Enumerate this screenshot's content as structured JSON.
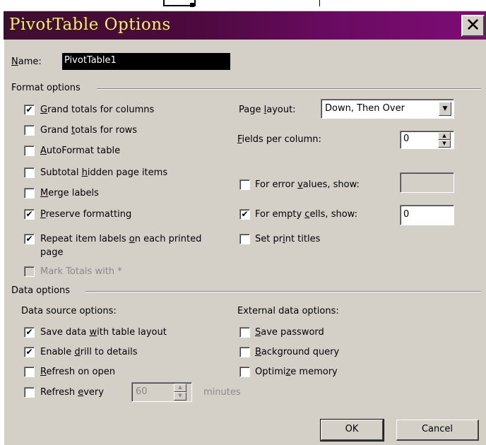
{
  "dialog": {
    "title": "PivotTable Options",
    "close_glyph": "✕"
  },
  "name": {
    "label": "Name:",
    "value": "PivotTable1"
  },
  "format_options": {
    "heading": "Format options",
    "grand_totals_columns": {
      "label": "Grand totals for columns",
      "checked": true
    },
    "grand_totals_rows": {
      "label": "Grand totals for rows",
      "checked": false
    },
    "autoformat": {
      "label": "AutoFormat table",
      "checked": false
    },
    "subtotal_hidden": {
      "label": "Subtotal hidden page items",
      "checked": false
    },
    "merge_labels": {
      "label": "Merge labels",
      "checked": false
    },
    "preserve_formatting": {
      "label": "Preserve formatting",
      "checked": true
    },
    "repeat_labels": {
      "label_line1": "Repeat item labels on each printed",
      "label_line2": "page",
      "checked": true
    },
    "mark_totals": {
      "label": "Mark Totals with *",
      "checked": false,
      "disabled": true
    },
    "page_layout": {
      "label": "Page layout:",
      "value": "Down, Then Over"
    },
    "fields_per_column": {
      "label": "Fields per column:",
      "value": "0"
    },
    "error_values": {
      "label": "For error values, show:",
      "checked": false,
      "value": ""
    },
    "empty_cells": {
      "label": "For empty cells, show:",
      "checked": true,
      "value": "0"
    },
    "print_titles": {
      "label": "Set print titles",
      "checked": false
    }
  },
  "data_options": {
    "heading": "Data options",
    "source_heading": "Data source options:",
    "external_heading": "External data options:",
    "save_data": {
      "label": "Save data with table layout",
      "checked": true
    },
    "enable_drill": {
      "label": "Enable drill to details",
      "checked": true
    },
    "refresh_open": {
      "label": "Refresh on open",
      "checked": false
    },
    "refresh_every": {
      "label": "Refresh every",
      "checked": false,
      "value": "60",
      "unit": "minutes"
    },
    "save_password": {
      "label": "Save password",
      "checked": false
    },
    "background_query": {
      "label": "Background query",
      "checked": false
    },
    "optimize_memory": {
      "label": "Optimize memory",
      "checked": false
    }
  },
  "buttons": {
    "ok": "OK",
    "cancel": "Cancel"
  },
  "check_glyph": "✔",
  "colors": {
    "title_text": "#f6f06c",
    "title_bg_start": "#3f0f2f",
    "title_bg_end": "#7e0c75",
    "face": "#d4d0c8"
  }
}
